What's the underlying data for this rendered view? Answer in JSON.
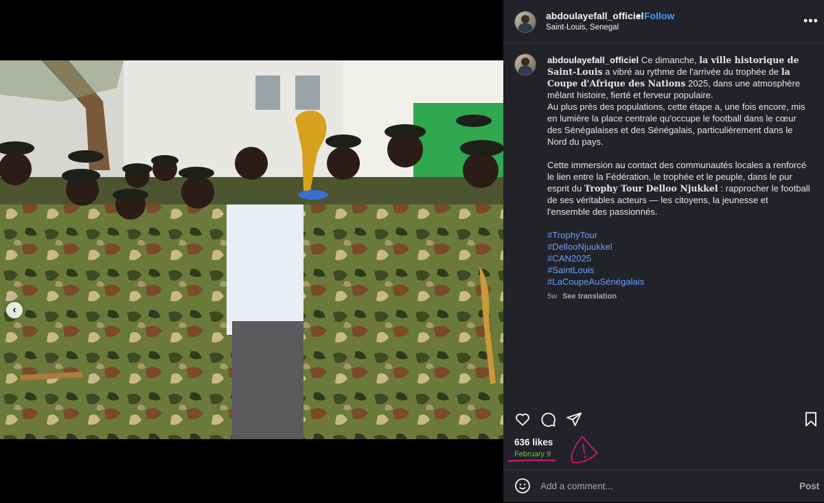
{
  "header": {
    "username": "abdoulayefall_officiel",
    "separator": "•",
    "follow_label": "Follow",
    "location": "Saint-Louis, Senegal",
    "more_icon": "ellipsis-icon"
  },
  "caption": {
    "username": "abdoulayefall_officiel",
    "p1_a": "Ce dimanche, ",
    "p1_b": "la ville historique de Saint-Louis",
    "p1_c": " a vibré au rythme de l'arrivée du trophée de ",
    "p1_d": "la Coupe d'Afrique des Nations",
    "p1_e": " 2025, dans une atmosphère mêlant histoire, fierté et ferveur populaire.",
    "p2": "Au plus près des populations, cette étape a, une fois encore, mis en lumière la place centrale qu'occupe le football dans le cœur des Sénégalaises et des Sénégalais, particulièrement dans le Nord du pays.",
    "p3_a": "Cette immersion au contact des communautés locales a renforcé le lien entre la Fédération, le trophée et le peuple, dans le pur esprit du ",
    "p3_b": "Trophy Tour Delloo Njukkel",
    "p3_c": " : rapprocher le football de ses véritables acteurs — les citoyens, la jeunesse et l'ensemble des passionnés.",
    "hashtags": [
      "#TrophyTour",
      "#DellooNjuukkel",
      "#CAN2025",
      "#SaintLouis",
      "#LaCoupeAuSénégalais"
    ],
    "age": "5w",
    "see_translation": "See translation"
  },
  "stats": {
    "likes": "636 likes",
    "date": "February 9"
  },
  "comment": {
    "placeholder": "Add a comment...",
    "post_label": "Post"
  },
  "carousel": {
    "prev_glyph": "‹",
    "dot_count": 9,
    "active_index": 8
  },
  "colors": {
    "panel_bg": "#212328",
    "link_blue": "#4a9cff",
    "hashtag_blue": "#6c9cff",
    "annotation": "#c2186b",
    "date_highlight": "#7bc043"
  }
}
